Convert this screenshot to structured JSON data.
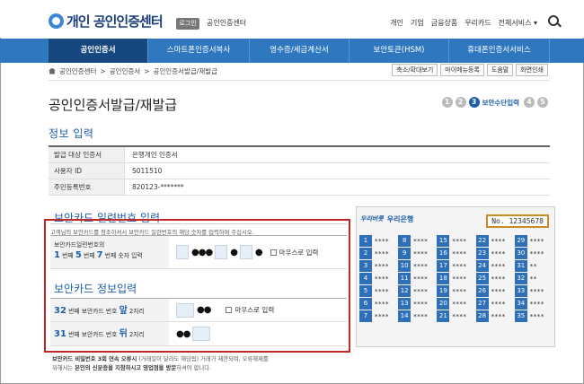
{
  "header": {
    "logo_text": "개인 공인인증센터",
    "login_button": "로그인",
    "top_crumb": "공인인증센터",
    "top_links": [
      "개인",
      "기업",
      "금융상품",
      "우리카드",
      "전체서비스 ▾"
    ]
  },
  "nav": {
    "items": [
      {
        "label": "공인인증서",
        "active": true
      },
      {
        "label": "스마트폰인증서복사",
        "active": false
      },
      {
        "label": "영수증/세금계산서",
        "active": false
      },
      {
        "label": "보안토큰(HSM)",
        "active": false
      },
      {
        "label": "휴대폰인증서서비스",
        "active": false
      }
    ]
  },
  "breadcrumb": {
    "items": [
      "공인인증센터",
      ">",
      "공인인증서",
      ">",
      "공인인증서발급/재발급"
    ],
    "tools": [
      "축소/확대보기",
      "마이메뉴등록",
      "도움말",
      "화면인쇄"
    ]
  },
  "page": {
    "title": "공인인증서발급/재발급",
    "steps": [
      "1",
      "2",
      "3",
      "4",
      "5"
    ],
    "active_step": "3",
    "active_step_label": "보안수단입력"
  },
  "info": {
    "title": "정보 입력",
    "rows": [
      {
        "key": "발급 대상 인증서",
        "value": "은행개인 인증서"
      },
      {
        "key": "사용자 ID",
        "value": "S011510"
      },
      {
        "key": "주민등록번호",
        "value": "820123-*******"
      }
    ]
  },
  "security_card": {
    "serial_title": "보안카드 일련번호 입력",
    "description": "고객님의 보안카드를 참조하셔서 보안카드 일련번호의 해당 숫자를 입력하여 주십시오.",
    "serial_label_top": "보안카드일련번호의",
    "serial_label_nums": [
      "1",
      "5",
      "7"
    ],
    "serial_label_unit": "번째",
    "serial_label_tail": "번째 숫자 입력",
    "mouse_input_label": "마우스로 입력",
    "info_title": "보안카드 정보입력",
    "row1": {
      "num": "32",
      "text": "번째 보안카드 번호",
      "pos": "앞",
      "tail": "2자리"
    },
    "row2": {
      "num": "31",
      "text": "번째 보안카드 번호",
      "pos": "뒤",
      "tail": "2자리"
    },
    "warning_line1_bold": "보안카드 비밀번호 3회 연속 오류시",
    "warning_line1_rest": "(거래일이 달라도 해당됨) 거래가 제한되며, 오류해제를",
    "warning_line2_pre": "위해서는",
    "warning_line2_bold": "본인의 신분증을 지참하시고 영업점을 방문",
    "warning_line2_post": "하셔야 합니다."
  },
  "card_image": {
    "brand": "우리은행",
    "slogan": "우리버릇",
    "serial": "No. 12345678",
    "cells": [
      {
        "n": "1",
        "s": "****"
      },
      {
        "n": "8",
        "s": "****"
      },
      {
        "n": "15",
        "s": "****"
      },
      {
        "n": "22",
        "s": "****"
      },
      {
        "n": "29",
        "s": "****"
      },
      {
        "n": "2",
        "s": "****"
      },
      {
        "n": "9",
        "s": "****"
      },
      {
        "n": "16",
        "s": "****"
      },
      {
        "n": "23",
        "s": "****"
      },
      {
        "n": "30",
        "s": "****"
      },
      {
        "n": "3",
        "s": "****"
      },
      {
        "n": "10",
        "s": "****"
      },
      {
        "n": "17",
        "s": "****"
      },
      {
        "n": "24",
        "s": "****"
      },
      {
        "n": "31",
        "s": "**"
      },
      {
        "n": "4",
        "s": "****"
      },
      {
        "n": "11",
        "s": "****"
      },
      {
        "n": "18",
        "s": "****"
      },
      {
        "n": "25",
        "s": "****"
      },
      {
        "n": "32",
        "s": "**"
      },
      {
        "n": "5",
        "s": "****"
      },
      {
        "n": "12",
        "s": "****"
      },
      {
        "n": "19",
        "s": "****"
      },
      {
        "n": "26",
        "s": "****"
      },
      {
        "n": "33",
        "s": "****"
      },
      {
        "n": "6",
        "s": "****"
      },
      {
        "n": "13",
        "s": "****"
      },
      {
        "n": "20",
        "s": "****"
      },
      {
        "n": "27",
        "s": "****"
      },
      {
        "n": "34",
        "s": "****"
      },
      {
        "n": "7",
        "s": "****"
      },
      {
        "n": "14",
        "s": "****"
      },
      {
        "n": "21",
        "s": "****"
      },
      {
        "n": "28",
        "s": "****"
      },
      {
        "n": "35",
        "s": "****"
      }
    ]
  }
}
